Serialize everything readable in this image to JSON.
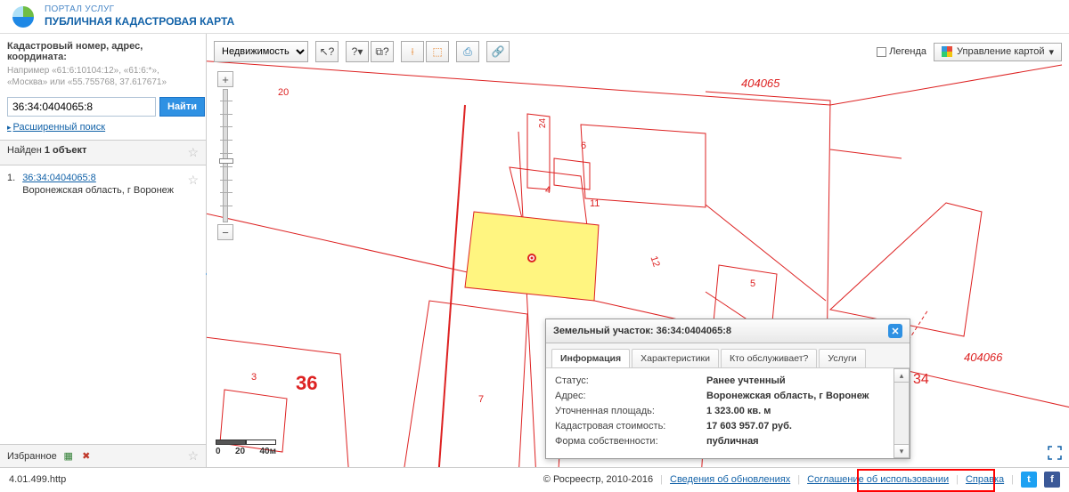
{
  "header": {
    "sub": "ПОРТАЛ УСЛУГ",
    "main": "ПУБЛИЧНАЯ КАДАСТРОВАЯ КАРТА"
  },
  "search": {
    "label": "Кадастровый номер, адрес, координата:",
    "hint": "Например «61:6:10104:12», «61:6:*», «Москва» или «55.755768, 37.617671»",
    "value": "36:34:0404065:8",
    "find_label": "Найти",
    "advanced_label": "Расширенный поиск"
  },
  "found": {
    "prefix": "Найден ",
    "count_bold": "1 объект"
  },
  "results": [
    {
      "index": "1.",
      "link": "36:34:0404065:8",
      "address": "Воронежская область, г Воронеж"
    }
  ],
  "favorites": {
    "label": "Избранное"
  },
  "toolbar": {
    "mode": "Недвижимость",
    "legend": "Легенда",
    "layers": "Управление картой"
  },
  "scale": {
    "s0": "0",
    "s1": "20",
    "s2": "40м"
  },
  "map_labels": {
    "big36": "36",
    "p3": "3",
    "p7": "7",
    "p4": "4",
    "p6": "6",
    "p11": "11",
    "p12": "12",
    "p5": "5",
    "p20": "20",
    "p24": "24",
    "p34": "34",
    "block1": "404065",
    "block2": "404066"
  },
  "popup": {
    "title": "Земельный участок: 36:34:0404065:8",
    "tabs": {
      "info": "Информация",
      "char": "Характеристики",
      "serve": "Кто обслуживает?",
      "services": "Услуги"
    },
    "fields": {
      "status_k": "Статус:",
      "status_v": "Ранее учтенный",
      "addr_k": "Адрес:",
      "addr_v": "Воронежская область, г Воронеж",
      "area_k": "Уточненная площадь:",
      "area_v": "1 323.00 кв. м",
      "cost_k": "Кадастровая стоимость:",
      "cost_v": "17 603 957.07 руб.",
      "own_k": "Форма собственности:",
      "own_v": "публичная"
    }
  },
  "footer": {
    "version": "4.01.499.http",
    "copyright": "© Росреестр, 2010-2016",
    "updates": "Сведения об обновлениях",
    "agreement": "Соглашение об использовании",
    "help": "Справка"
  }
}
